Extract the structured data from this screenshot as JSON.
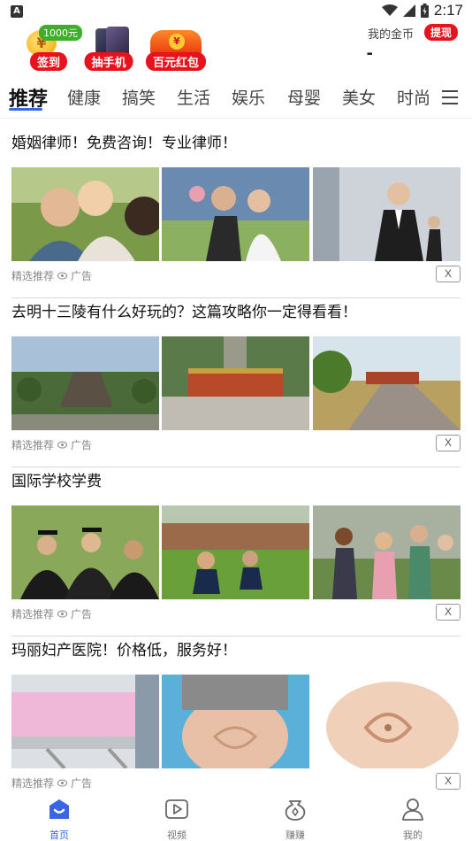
{
  "status_bar": {
    "time": "2:17",
    "left_glyph": "A"
  },
  "promo": {
    "checkin": {
      "label": "签到",
      "tag": "1000元"
    },
    "draw_phone": {
      "label": "抽手机"
    },
    "red_packet": {
      "label": "百元红包"
    }
  },
  "gold": {
    "label": "我的金币",
    "withdraw": "提现",
    "value": "-"
  },
  "tabs": [
    {
      "label": "推荐",
      "active": true
    },
    {
      "label": "健康"
    },
    {
      "label": "搞笑"
    },
    {
      "label": "生活"
    },
    {
      "label": "娱乐"
    },
    {
      "label": "母婴"
    },
    {
      "label": "美女"
    },
    {
      "label": "时尚"
    }
  ],
  "feed": [
    {
      "title": "婚姻律师！免费咨询！专业律师！",
      "source": "精选推荐",
      "ad_label": "广告",
      "close": "X"
    },
    {
      "title": "去明十三陵有什么好玩的？这篇攻略你一定得看看！",
      "source": "精选推荐",
      "ad_label": "广告",
      "close": "X"
    },
    {
      "title": "国际学校学费",
      "source": "精选推荐",
      "ad_label": "广告",
      "close": "X"
    },
    {
      "title": "玛丽妇产医院！价格低，服务好！",
      "source": "精选推荐",
      "ad_label": "广告",
      "close": "X"
    }
  ],
  "bottom_nav": [
    {
      "label": "首页",
      "icon": "home-icon",
      "active": true
    },
    {
      "label": "视频",
      "icon": "video-icon"
    },
    {
      "label": "赚赚",
      "icon": "earn-icon"
    },
    {
      "label": "我的",
      "icon": "profile-icon"
    }
  ],
  "colors": {
    "accent": "#3a66e6",
    "brand_red": "#e8121d"
  }
}
